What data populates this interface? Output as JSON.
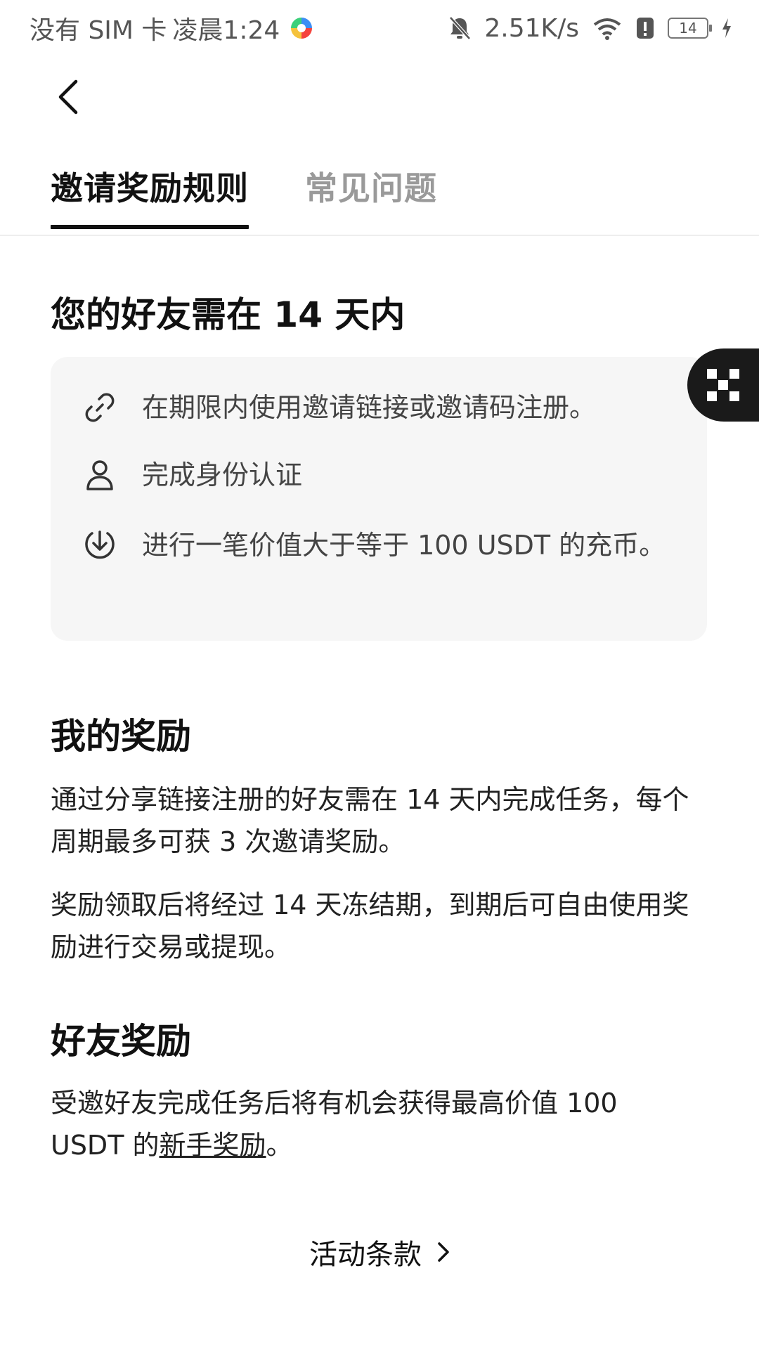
{
  "status_bar": {
    "carrier": "没有 SIM 卡",
    "time": "凌晨1:24",
    "net_speed": "2.51K/s",
    "battery": "14"
  },
  "tabs": [
    {
      "label": "邀请奖励规则",
      "active": true
    },
    {
      "label": "常见问题",
      "active": false
    }
  ],
  "requirements": {
    "title": "您的好友需在 14 天内",
    "items": [
      {
        "icon": "link-icon",
        "text": "在期限内使用邀请链接或邀请码注册。"
      },
      {
        "icon": "user-icon",
        "text": "完成身份认证"
      },
      {
        "icon": "deposit-icon",
        "text": "进行一笔价值大于等于 100 USDT 的充币。"
      }
    ]
  },
  "my_rewards": {
    "title": "我的奖励",
    "paragraphs": [
      "通过分享链接注册的好友需在 14 天内完成任务，每个周期最多可获 3 次邀请奖励。",
      "奖励领取后将经过 14 天冻结期，到期后可自由使用奖励进行交易或提现。"
    ]
  },
  "friend_rewards": {
    "title": "好友奖励",
    "text_before": "受邀好友完成任务后将有机会获得最高价值 100 USDT 的",
    "link": "新手奖励",
    "text_after": "。"
  },
  "terms_label": "活动条款",
  "colors": {
    "primary_text": "#111111",
    "secondary_text": "#444444",
    "inactive_tab": "#9a9a9a",
    "card_bg": "#f6f6f6",
    "float_button": "#1a1a1a"
  }
}
